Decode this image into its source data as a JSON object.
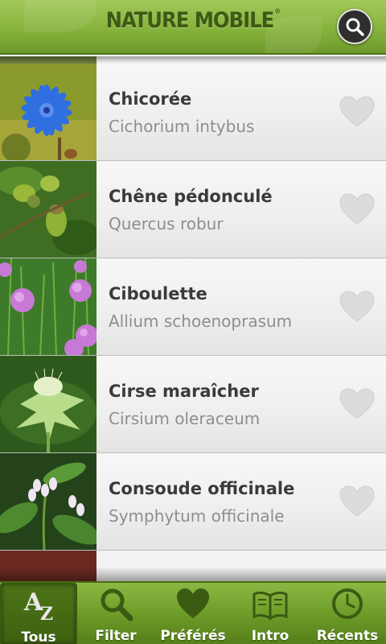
{
  "header": {
    "logo_text": "NATURE MOBILE",
    "logo_mark": "®",
    "search_icon": "search-icon"
  },
  "species": [
    {
      "name": "Chicorée",
      "latin": "Cichorium intybus",
      "favorite": false
    },
    {
      "name": "Chêne pédonculé",
      "latin": "Quercus robur",
      "favorite": false
    },
    {
      "name": "Ciboulette",
      "latin": "Allium schoenoprasum",
      "favorite": false
    },
    {
      "name": "Cirse maraîcher",
      "latin": "Cirsium oleraceum",
      "favorite": false
    },
    {
      "name": "Consoude officinale",
      "latin": "Symphytum officinale",
      "favorite": false
    }
  ],
  "tabs": [
    {
      "label": "Tous",
      "icon": "az-icon",
      "selected": true
    },
    {
      "label": "Filter",
      "icon": "magnifier-icon",
      "selected": false
    },
    {
      "label": "Préférés",
      "icon": "heart-icon",
      "selected": false
    },
    {
      "label": "Intro",
      "icon": "book-icon",
      "selected": false
    },
    {
      "label": "Récents",
      "icon": "clock-icon",
      "selected": false
    }
  ],
  "colors": {
    "header_green": "#86b33c",
    "text_dark": "#3a3a3a",
    "text_gray": "#8e8e8e",
    "heart_gray": "#d9d9d9"
  }
}
